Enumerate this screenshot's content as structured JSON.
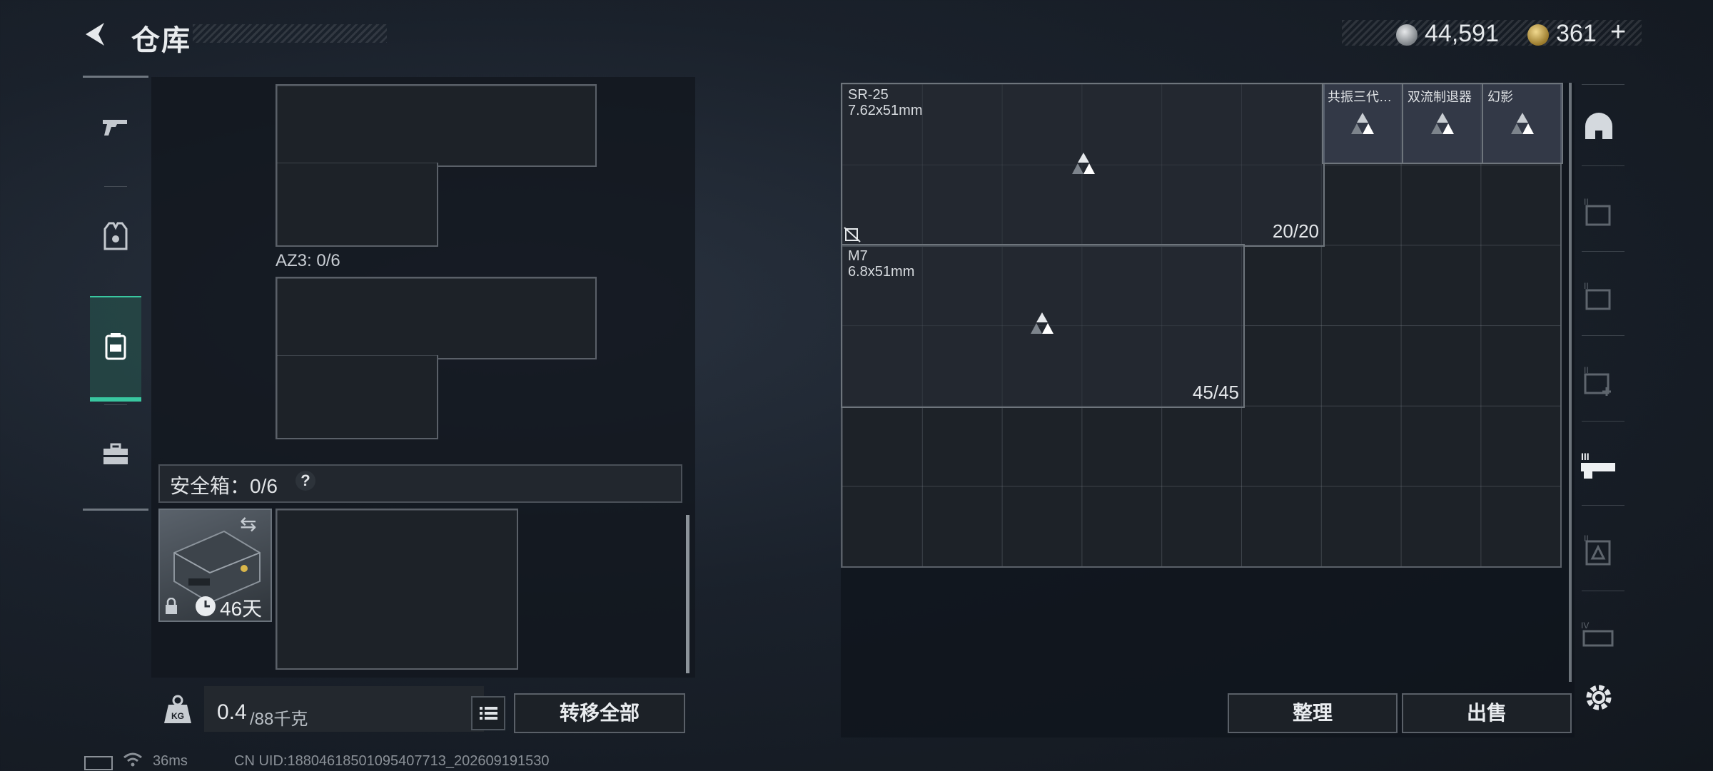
{
  "header": {
    "title": "仓库"
  },
  "currency": [
    {
      "value": "44,591",
      "icon": "silver-coin-icon"
    },
    {
      "value": "361",
      "plus": "+",
      "icon": "gold-coin-icon"
    }
  ],
  "left_rail": [
    {
      "icon": "gun-icon"
    },
    {
      "icon": "vest-icon"
    },
    {
      "icon": "backpack-icon",
      "selected": true
    },
    {
      "icon": "toolbox-icon"
    }
  ],
  "left": {
    "az3_label": "AZ3: 0/6",
    "safe_label": "安全箱：0/6",
    "safe_help": "?",
    "case_days": "46天",
    "weight_value": "0.4",
    "weight_max": "/88千克",
    "transfer_label": "转移全部"
  },
  "right": {
    "items": [
      {
        "name": "SR-25",
        "caliber": "7.62x51mm",
        "count": "20/20"
      },
      {
        "name": "M7",
        "caliber": "6.8x51mm",
        "count": "45/45"
      }
    ],
    "attachments": [
      "共振三代…",
      "双流制退器",
      "幻影"
    ],
    "arrange_label": "整理",
    "sell_label": "出售"
  },
  "right_rail": [
    "helmet-icon",
    "ammo-box-II-icon",
    "ammo-box-II-icon-2",
    "medkit-II-icon",
    "rifle-III-icon",
    "scope-II-icon",
    "weapon-IV-icon",
    "settings-icon"
  ],
  "status": {
    "ping": "36ms",
    "uid": "CN UID:18804618501095407713_202609191530"
  },
  "colors": {
    "accent": "#39c7a0"
  }
}
